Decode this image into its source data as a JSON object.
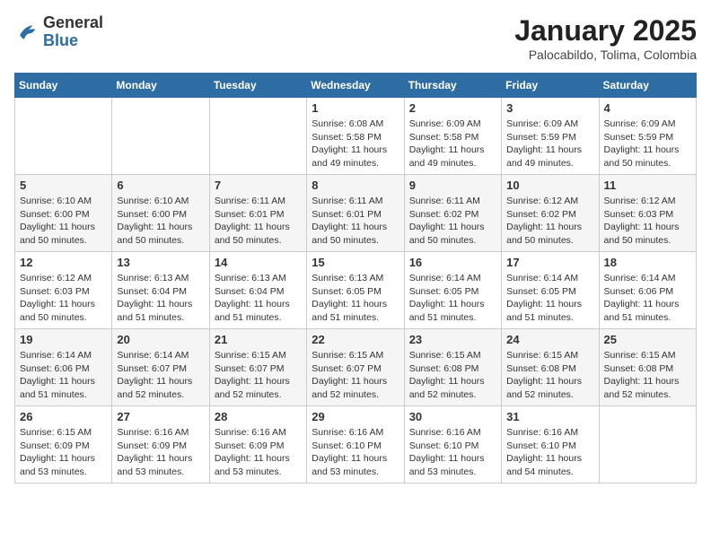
{
  "header": {
    "logo_general": "General",
    "logo_blue": "Blue",
    "month_title": "January 2025",
    "subtitle": "Palocabildo, Tolima, Colombia"
  },
  "days_of_week": [
    "Sunday",
    "Monday",
    "Tuesday",
    "Wednesday",
    "Thursday",
    "Friday",
    "Saturday"
  ],
  "weeks": [
    {
      "cells": [
        {
          "day": null
        },
        {
          "day": null
        },
        {
          "day": null
        },
        {
          "day": "1",
          "sunrise": "6:08 AM",
          "sunset": "5:58 PM",
          "daylight": "11 hours and 49 minutes."
        },
        {
          "day": "2",
          "sunrise": "6:09 AM",
          "sunset": "5:58 PM",
          "daylight": "11 hours and 49 minutes."
        },
        {
          "day": "3",
          "sunrise": "6:09 AM",
          "sunset": "5:59 PM",
          "daylight": "11 hours and 49 minutes."
        },
        {
          "day": "4",
          "sunrise": "6:09 AM",
          "sunset": "5:59 PM",
          "daylight": "11 hours and 50 minutes."
        }
      ]
    },
    {
      "cells": [
        {
          "day": "5",
          "sunrise": "6:10 AM",
          "sunset": "6:00 PM",
          "daylight": "11 hours and 50 minutes."
        },
        {
          "day": "6",
          "sunrise": "6:10 AM",
          "sunset": "6:00 PM",
          "daylight": "11 hours and 50 minutes."
        },
        {
          "day": "7",
          "sunrise": "6:11 AM",
          "sunset": "6:01 PM",
          "daylight": "11 hours and 50 minutes."
        },
        {
          "day": "8",
          "sunrise": "6:11 AM",
          "sunset": "6:01 PM",
          "daylight": "11 hours and 50 minutes."
        },
        {
          "day": "9",
          "sunrise": "6:11 AM",
          "sunset": "6:02 PM",
          "daylight": "11 hours and 50 minutes."
        },
        {
          "day": "10",
          "sunrise": "6:12 AM",
          "sunset": "6:02 PM",
          "daylight": "11 hours and 50 minutes."
        },
        {
          "day": "11",
          "sunrise": "6:12 AM",
          "sunset": "6:03 PM",
          "daylight": "11 hours and 50 minutes."
        }
      ]
    },
    {
      "cells": [
        {
          "day": "12",
          "sunrise": "6:12 AM",
          "sunset": "6:03 PM",
          "daylight": "11 hours and 50 minutes."
        },
        {
          "day": "13",
          "sunrise": "6:13 AM",
          "sunset": "6:04 PM",
          "daylight": "11 hours and 51 minutes."
        },
        {
          "day": "14",
          "sunrise": "6:13 AM",
          "sunset": "6:04 PM",
          "daylight": "11 hours and 51 minutes."
        },
        {
          "day": "15",
          "sunrise": "6:13 AM",
          "sunset": "6:05 PM",
          "daylight": "11 hours and 51 minutes."
        },
        {
          "day": "16",
          "sunrise": "6:14 AM",
          "sunset": "6:05 PM",
          "daylight": "11 hours and 51 minutes."
        },
        {
          "day": "17",
          "sunrise": "6:14 AM",
          "sunset": "6:05 PM",
          "daylight": "11 hours and 51 minutes."
        },
        {
          "day": "18",
          "sunrise": "6:14 AM",
          "sunset": "6:06 PM",
          "daylight": "11 hours and 51 minutes."
        }
      ]
    },
    {
      "cells": [
        {
          "day": "19",
          "sunrise": "6:14 AM",
          "sunset": "6:06 PM",
          "daylight": "11 hours and 51 minutes."
        },
        {
          "day": "20",
          "sunrise": "6:14 AM",
          "sunset": "6:07 PM",
          "daylight": "11 hours and 52 minutes."
        },
        {
          "day": "21",
          "sunrise": "6:15 AM",
          "sunset": "6:07 PM",
          "daylight": "11 hours and 52 minutes."
        },
        {
          "day": "22",
          "sunrise": "6:15 AM",
          "sunset": "6:07 PM",
          "daylight": "11 hours and 52 minutes."
        },
        {
          "day": "23",
          "sunrise": "6:15 AM",
          "sunset": "6:08 PM",
          "daylight": "11 hours and 52 minutes."
        },
        {
          "day": "24",
          "sunrise": "6:15 AM",
          "sunset": "6:08 PM",
          "daylight": "11 hours and 52 minutes."
        },
        {
          "day": "25",
          "sunrise": "6:15 AM",
          "sunset": "6:08 PM",
          "daylight": "11 hours and 52 minutes."
        }
      ]
    },
    {
      "cells": [
        {
          "day": "26",
          "sunrise": "6:15 AM",
          "sunset": "6:09 PM",
          "daylight": "11 hours and 53 minutes."
        },
        {
          "day": "27",
          "sunrise": "6:16 AM",
          "sunset": "6:09 PM",
          "daylight": "11 hours and 53 minutes."
        },
        {
          "day": "28",
          "sunrise": "6:16 AM",
          "sunset": "6:09 PM",
          "daylight": "11 hours and 53 minutes."
        },
        {
          "day": "29",
          "sunrise": "6:16 AM",
          "sunset": "6:10 PM",
          "daylight": "11 hours and 53 minutes."
        },
        {
          "day": "30",
          "sunrise": "6:16 AM",
          "sunset": "6:10 PM",
          "daylight": "11 hours and 53 minutes."
        },
        {
          "day": "31",
          "sunrise": "6:16 AM",
          "sunset": "6:10 PM",
          "daylight": "11 hours and 54 minutes."
        },
        {
          "day": null
        }
      ]
    }
  ]
}
